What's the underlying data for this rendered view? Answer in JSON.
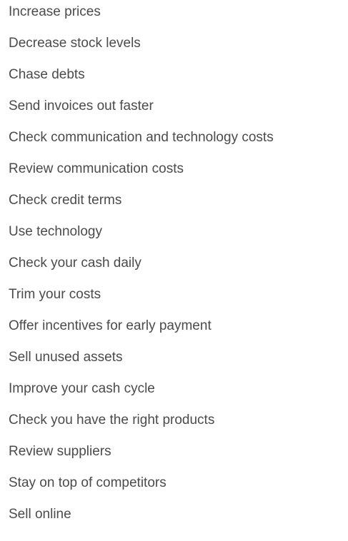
{
  "items": [
    "Increase prices",
    "Decrease stock levels",
    "Chase debts",
    "Send invoices out faster",
    "Check communication and technology costs",
    "Review communication costs",
    "Check credit terms",
    "Use technology",
    "Check your cash daily",
    "Trim your costs",
    "Offer incentives for early payment",
    "Sell unused assets",
    "Improve your cash cycle",
    "Check you have the right products",
    "Review suppliers",
    "Stay on top of competitors",
    "Sell online"
  ]
}
